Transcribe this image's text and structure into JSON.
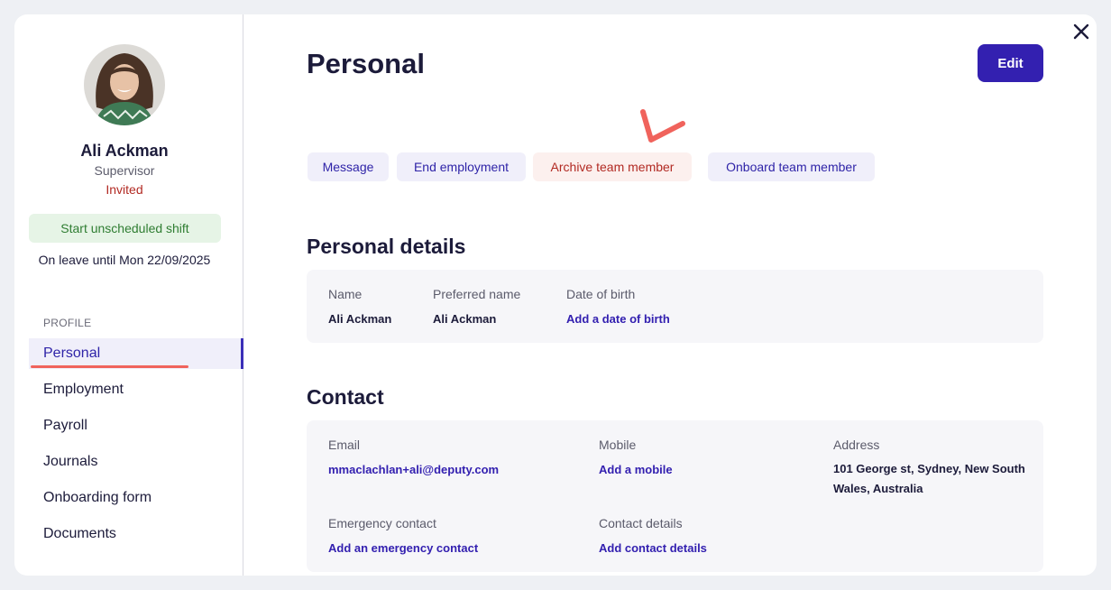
{
  "profile": {
    "name": "Ali Ackman",
    "role": "Supervisor",
    "status": "Invited",
    "shift_button": "Start unscheduled shift",
    "leave_text": "On leave until Mon 22/09/2025"
  },
  "sidebar": {
    "section_label": "PROFILE",
    "items": [
      {
        "label": "Personal",
        "active": true
      },
      {
        "label": "Employment"
      },
      {
        "label": "Payroll"
      },
      {
        "label": "Journals"
      },
      {
        "label": "Onboarding form"
      },
      {
        "label": "Documents"
      }
    ]
  },
  "header": {
    "title": "Personal",
    "edit_label": "Edit"
  },
  "actions": {
    "message": "Message",
    "end_employment": "End employment",
    "archive": "Archive team member",
    "onboard": "Onboard team member"
  },
  "personal_details": {
    "heading": "Personal details",
    "name_label": "Name",
    "name_value": "Ali Ackman",
    "preferred_label": "Preferred name",
    "preferred_value": "Ali Ackman",
    "dob_label": "Date of birth",
    "dob_link": "Add a date of birth"
  },
  "contact": {
    "heading": "Contact",
    "email_label": "Email",
    "email_value": "mmaclachlan+ali@deputy.com",
    "mobile_label": "Mobile",
    "mobile_link": "Add a mobile",
    "address_label": "Address",
    "address_value": "101 George st, Sydney, New South Wales, Australia",
    "emergency_label": "Emergency contact",
    "emergency_link": "Add an emergency contact",
    "details_label": "Contact details",
    "details_link": "Add contact details"
  },
  "colors": {
    "primary": "#3320b0",
    "danger": "#b22a23",
    "success": "#2f7d32",
    "annotation": "#f0635c"
  }
}
